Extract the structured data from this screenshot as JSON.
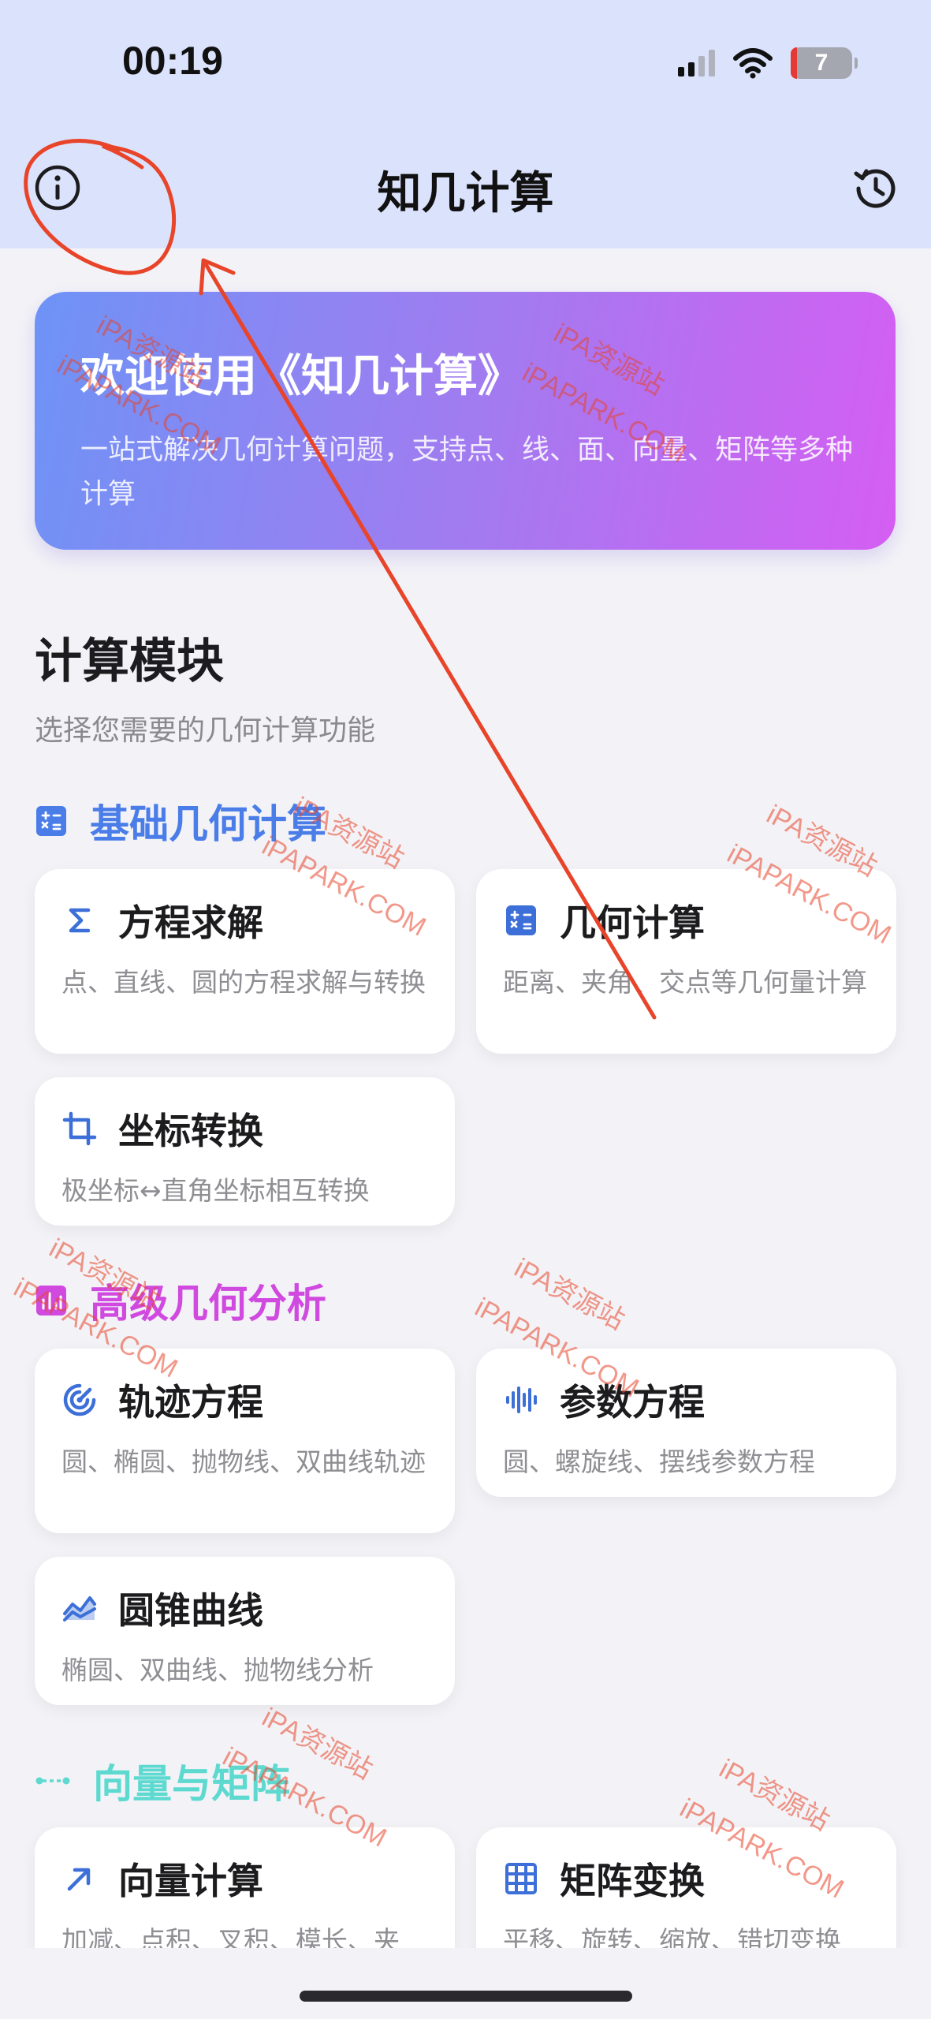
{
  "status": {
    "time": "00:19",
    "battery": "7"
  },
  "nav": {
    "title": "知几计算"
  },
  "banner": {
    "title": "欢迎使用《知几计算》",
    "subtitle": "一站式解决几何计算问题，支持点、线、面、向量、矩阵等多种计算"
  },
  "modules": {
    "heading": "计算模块",
    "subtitle": "选择您需要的几何计算功能"
  },
  "groups": [
    {
      "title": "基础几何计算",
      "color": "#4a7de8",
      "icon": "calculator-icon"
    },
    {
      "title": "高级几何分析",
      "color": "#d04ae0",
      "icon": "chart-box-icon"
    },
    {
      "title": "向量与矩阵",
      "color": "#5ed9d0",
      "icon": "dots-line-icon"
    }
  ],
  "cards": [
    {
      "title": "方程求解",
      "desc": "点、直线、圆的方程求解与转换",
      "icon": "sigma-icon"
    },
    {
      "title": "几何计算",
      "desc": "距离、夹角、交点等几何量计算",
      "icon": "calculator-icon"
    },
    {
      "title": "坐标转换",
      "desc": "极坐标↔直角坐标相互转换",
      "icon": "crop-icon"
    },
    {
      "title": "轨迹方程",
      "desc": "圆、椭圆、抛物线、双曲线轨迹",
      "icon": "radar-icon"
    },
    {
      "title": "参数方程",
      "desc": "圆、螺旋线、摆线参数方程",
      "icon": "waveform-icon"
    },
    {
      "title": "圆锥曲线",
      "desc": "椭圆、双曲线、抛物线分析",
      "icon": "area-chart-icon"
    },
    {
      "title": "向量计算",
      "desc": "加减、点积、叉积、模长、夹",
      "icon": "arrow-up-right-icon"
    },
    {
      "title": "矩阵变换",
      "desc": "平移、旋转、缩放、错切变换",
      "icon": "grid-icon"
    }
  ],
  "watermarks": [
    "iPA资源站",
    "iPAPARK.COM"
  ],
  "colors": {
    "accent": "#4a7de8",
    "annotation": "#e8442a"
  }
}
